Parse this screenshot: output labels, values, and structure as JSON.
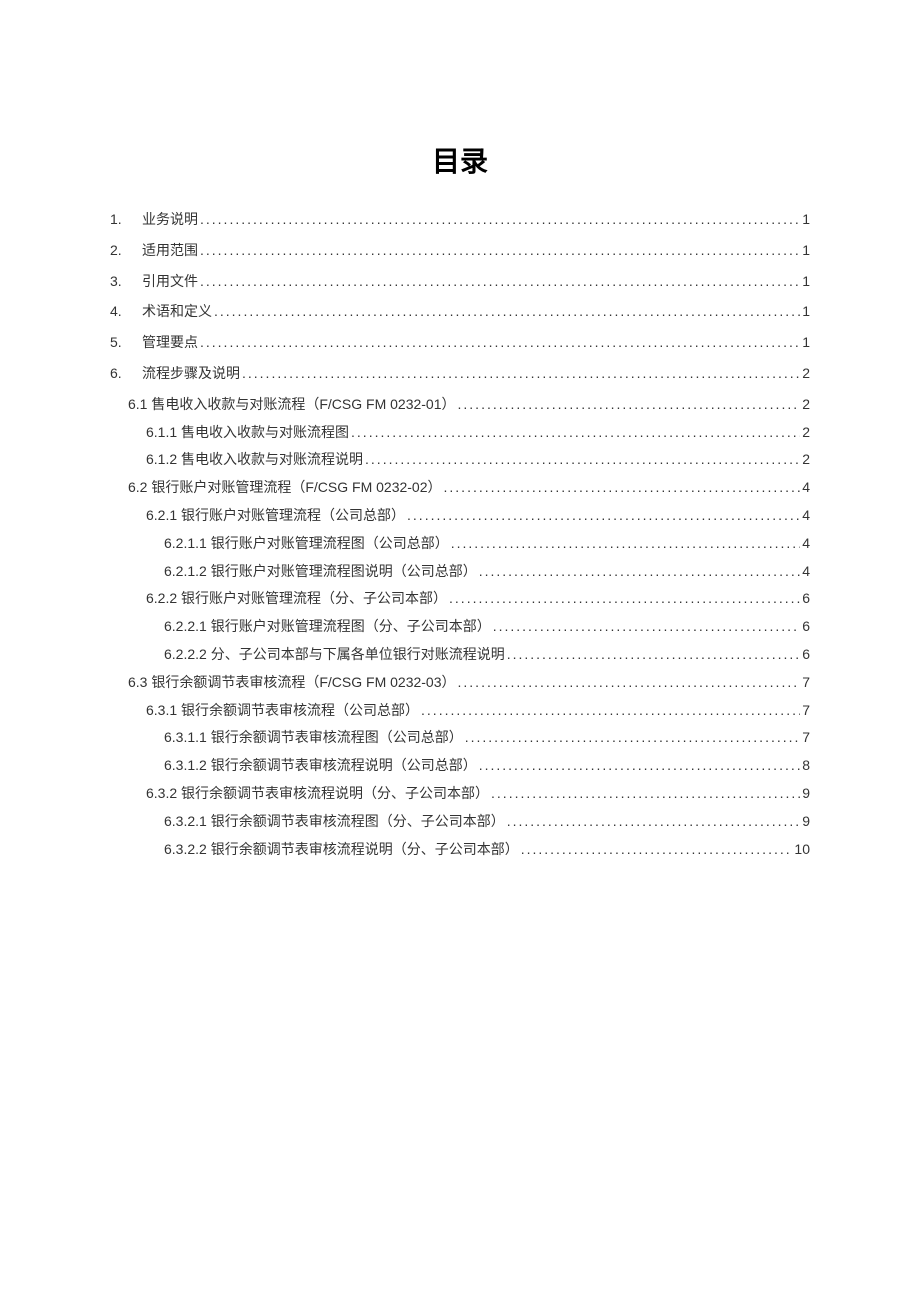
{
  "title": "目录",
  "entries": [
    {
      "num": "1.",
      "label": "业务说明",
      "page": "1",
      "indent": 0,
      "style": "loose"
    },
    {
      "num": "2.",
      "label": "适用范围",
      "page": "1",
      "indent": 0,
      "style": "loose"
    },
    {
      "num": "3.",
      "label": "引用文件",
      "page": "1",
      "indent": 0,
      "style": "loose"
    },
    {
      "num": "4.",
      "label": "术语和定义",
      "page": "1",
      "indent": 0,
      "style": "loose"
    },
    {
      "num": "5.",
      "label": "管理要点",
      "page": "1",
      "indent": 0,
      "style": "loose"
    },
    {
      "num": "6.",
      "label": "流程步骤及说明",
      "page": "2",
      "indent": 0,
      "style": "loose"
    },
    {
      "num": "",
      "label": "6.1 售电收入收款与对账流程（F/CSG FM 0232-01）",
      "page": "2",
      "indent": 1,
      "style": "tight"
    },
    {
      "num": "",
      "label": "6.1.1 售电收入收款与对账流程图",
      "page": "2",
      "indent": 2,
      "style": "tight"
    },
    {
      "num": "",
      "label": "6.1.2 售电收入收款与对账流程说明",
      "page": "2",
      "indent": 2,
      "style": "tight"
    },
    {
      "num": "",
      "label": "6.2 银行账户对账管理流程（F/CSG FM 0232-02）",
      "page": "4",
      "indent": 1,
      "style": "tight"
    },
    {
      "num": "",
      "label": "6.2.1 银行账户对账管理流程（公司总部）",
      "page": "4",
      "indent": 2,
      "style": "tight"
    },
    {
      "num": "",
      "label": "6.2.1.1 银行账户对账管理流程图（公司总部）",
      "page": "4",
      "indent": 3,
      "style": "tight"
    },
    {
      "num": "",
      "label": "6.2.1.2 银行账户对账管理流程图说明（公司总部）",
      "page": "4",
      "indent": 3,
      "style": "tight"
    },
    {
      "num": "",
      "label": "6.2.2 银行账户对账管理流程（分、子公司本部）",
      "page": "6",
      "indent": 2,
      "style": "tight"
    },
    {
      "num": "",
      "label": "6.2.2.1 银行账户对账管理流程图（分、子公司本部）",
      "page": "6",
      "indent": 3,
      "style": "tight"
    },
    {
      "num": "",
      "label": "6.2.2.2 分、子公司本部与下属各单位银行对账流程说明",
      "page": "6",
      "indent": 3,
      "style": "tight"
    },
    {
      "num": "",
      "label": "6.3 银行余额调节表审核流程（F/CSG FM 0232-03）",
      "page": "7",
      "indent": 1,
      "style": "tight"
    },
    {
      "num": "",
      "label": "6.3.1 银行余额调节表审核流程（公司总部）",
      "page": "7",
      "indent": 2,
      "style": "tight"
    },
    {
      "num": "",
      "label": "6.3.1.1 银行余额调节表审核流程图（公司总部）",
      "page": "7",
      "indent": 3,
      "style": "tight"
    },
    {
      "num": "",
      "label": "6.3.1.2 银行余额调节表审核流程说明（公司总部）",
      "page": "8",
      "indent": 3,
      "style": "tight"
    },
    {
      "num": "",
      "label": "6.3.2 银行余额调节表审核流程说明（分、子公司本部）",
      "page": "9",
      "indent": 2,
      "style": "tight"
    },
    {
      "num": "",
      "label": "6.3.2.1 银行余额调节表审核流程图（分、子公司本部）",
      "page": "9",
      "indent": 3,
      "style": "tight"
    },
    {
      "num": "",
      "label": "6.3.2.2 银行余额调节表审核流程说明（分、子公司本部）",
      "page": "10",
      "indent": 3,
      "style": "tight"
    }
  ]
}
